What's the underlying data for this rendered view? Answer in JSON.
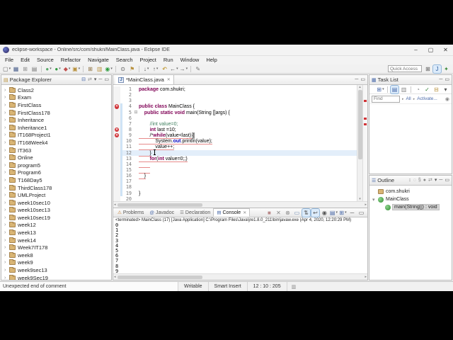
{
  "window": {
    "title": "eclipse-workspace - Online/src/com/shukri/MainClass.java - Eclipse IDE",
    "controls": [
      {
        "name": "minimize-button",
        "glyph": "–"
      },
      {
        "name": "maximize-button",
        "glyph": "▢"
      },
      {
        "name": "close-button",
        "glyph": "✕"
      }
    ]
  },
  "menubar": [
    "File",
    "Edit",
    "Source",
    "Refactor",
    "Navigate",
    "Search",
    "Project",
    "Run",
    "Window",
    "Help"
  ],
  "toolbar": {
    "quick_access": "Quick Access",
    "caret_glyph": "▾",
    "icons": [
      {
        "name": "new-wizard-icon",
        "glyph": "▢",
        "color": "#666",
        "caret": true
      },
      {
        "name": "save-icon",
        "glyph": "▦",
        "color": "#4a5f8c"
      },
      {
        "name": "save-all-icon",
        "glyph": "⊞",
        "color": "#8a8a8a"
      },
      {
        "name": "print-icon",
        "glyph": "▤",
        "color": "#777"
      },
      {
        "sep": true
      },
      {
        "name": "debug-icon",
        "glyph": "●",
        "color": "#59a869",
        "caret": true
      },
      {
        "name": "run-icon",
        "glyph": "●",
        "color": "#2e9b3e",
        "caret": true
      },
      {
        "name": "profile-icon",
        "glyph": "◆",
        "color": "#c0504d",
        "caret": true
      },
      {
        "name": "coverage-icon",
        "glyph": "▣",
        "color": "#b8913d",
        "caret": true
      },
      {
        "sep": true
      },
      {
        "name": "new-java-project-icon",
        "glyph": "⊞",
        "color": "#8a6d3b"
      },
      {
        "name": "new-package-icon",
        "glyph": "▥",
        "color": "#b8913d"
      },
      {
        "name": "new-class-icon",
        "glyph": "◉",
        "color": "#2e9b3e",
        "caret": true
      },
      {
        "sep": true
      },
      {
        "name": "search-icon",
        "glyph": "⊙",
        "color": "#555"
      },
      {
        "name": "open-task-icon",
        "glyph": "⚑",
        "color": "#b8913d"
      },
      {
        "sep": true
      },
      {
        "name": "next-annotation-icon",
        "glyph": "↓",
        "color": "#555",
        "caret": true
      },
      {
        "name": "prev-annotation-icon",
        "glyph": "↑",
        "color": "#555",
        "caret": true
      },
      {
        "name": "last-edit-location-icon",
        "glyph": "↶",
        "color": "#b8860b"
      },
      {
        "name": "back-icon",
        "glyph": "←",
        "color": "#555",
        "caret": true
      },
      {
        "name": "forward-icon",
        "glyph": "→",
        "color": "#555",
        "caret": true
      },
      {
        "sep": true
      },
      {
        "name": "mark-occurrences-icon",
        "glyph": "✎",
        "color": "#777"
      }
    ],
    "right_icons": [
      {
        "name": "open-perspective-icon",
        "glyph": "⊞",
        "color": "#555"
      },
      {
        "name": "java-perspective-icon",
        "glyph": "J",
        "color": "#2f5f9f",
        "toggled": true
      },
      {
        "name": "debug-perspective-icon",
        "glyph": "✦",
        "color": "#3c8c3c"
      }
    ]
  },
  "package_explorer": {
    "title": "Package Explorer",
    "tab_icon": "▤",
    "twist_glyph": "›",
    "header_icons": [
      {
        "name": "collapse-all-icon",
        "glyph": "⊟",
        "color": "#4868a8"
      },
      {
        "name": "link-with-editor-icon",
        "glyph": "⇄",
        "color": "#888"
      },
      {
        "name": "view-menu-icon",
        "glyph": "▾",
        "color": "#555"
      },
      {
        "name": "minimize-icon",
        "glyph": "─",
        "color": "#555"
      },
      {
        "name": "maximize-icon",
        "glyph": "▭",
        "color": "#555"
      }
    ],
    "items": [
      "Class2",
      "Exam",
      "FirstClass",
      "FirstClass178",
      "Inheritance",
      "Inheritance1",
      "IT168Project1",
      "IT168Week4",
      "IT363",
      "Online",
      "program5",
      "Program6",
      "T168Day5",
      "ThirdClass178",
      "UMLProject",
      "week10sec10",
      "week10sec13",
      "week10sec19",
      "week12",
      "week13",
      "week14",
      "Week7IT178",
      "week8",
      "week9",
      "week9sec13",
      "week9Sec19"
    ]
  },
  "editor": {
    "tab": {
      "icon_label": "J",
      "title": "*MainClass.java",
      "close_glyph": "✕"
    },
    "header_icons": [
      {
        "name": "minimize-icon",
        "glyph": "─",
        "color": "#555"
      },
      {
        "name": "maximize-icon",
        "glyph": "▭",
        "color": "#555"
      }
    ],
    "error_glyph": "✕",
    "fold_glyph": "⊟",
    "range_indicator": {
      "from": 4,
      "to": 19
    },
    "scrollbar": {
      "up": "▴",
      "down": "▾",
      "left": "◂",
      "right": "▸"
    },
    "overview_marks": [
      {
        "top": "13%",
        "color": "#d13438"
      },
      {
        "top": "28%",
        "color": "#d13438"
      },
      {
        "top": "33%",
        "color": "#d13438"
      }
    ],
    "lines": [
      {
        "n": 1,
        "segs": [
          [
            "kw",
            "package"
          ],
          [
            "p",
            " com.shukri;"
          ]
        ]
      },
      {
        "n": 2,
        "segs": []
      },
      {
        "n": 3,
        "segs": []
      },
      {
        "n": 4,
        "marker": "error",
        "segs": [
          [
            "kw",
            "public"
          ],
          [
            "p",
            " "
          ],
          [
            "kw",
            "class"
          ],
          [
            "p",
            " MainClass {"
          ]
        ]
      },
      {
        "n": 5,
        "fold": true,
        "segs": [
          [
            "p",
            "    "
          ],
          [
            "kw",
            "public"
          ],
          [
            "p",
            " "
          ],
          [
            "kw",
            "static"
          ],
          [
            "p",
            " "
          ],
          [
            "kw",
            "void"
          ],
          [
            "p",
            " main(String []args) {"
          ]
        ]
      },
      {
        "n": 6,
        "segs": []
      },
      {
        "n": 7,
        "segs": [
          [
            "p",
            "        "
          ],
          [
            "com",
            "//int value=0;"
          ]
        ]
      },
      {
        "n": 8,
        "marker": "error",
        "segs": [
          [
            "p",
            "        "
          ],
          [
            "kw",
            "int"
          ],
          [
            "p",
            " last =10;"
          ]
        ]
      },
      {
        "n": 9,
        "marker": "error",
        "segs": [
          [
            "p u",
            "        /*"
          ],
          [
            "kw u",
            "while"
          ],
          [
            "p u",
            "(value<last) "
          ],
          [
            "box",
            "{"
          ]
        ]
      },
      {
        "n": 10,
        "segs": [
          [
            "p u",
            "            System."
          ],
          [
            "field u",
            "out"
          ],
          [
            "p u",
            ".println(value);"
          ]
        ]
      },
      {
        "n": 11,
        "segs": [
          [
            "p u",
            "            value++;"
          ]
        ]
      },
      {
        "n": 12,
        "hl": true,
        "caret": true,
        "segs": [
          [
            "p u",
            "        }"
          ],
          [
            "p",
            "  "
          ]
        ]
      },
      {
        "n": 13,
        "segs": [
          [
            "p u",
            "        "
          ],
          [
            "kw u",
            "for"
          ],
          [
            "p u",
            "("
          ],
          [
            "kw u",
            "int"
          ],
          [
            "p u",
            " value=0;;)"
          ]
        ]
      },
      {
        "n": 14,
        "segs": [
          [
            "p u",
            "        "
          ]
        ]
      },
      {
        "n": 15,
        "segs": [
          [
            "p u",
            "        "
          ]
        ]
      },
      {
        "n": 16,
        "segs": [
          [
            "p u",
            "    }"
          ]
        ]
      },
      {
        "n": 17,
        "segs": []
      },
      {
        "n": 18,
        "segs": []
      },
      {
        "n": 19,
        "segs": [
          [
            "p",
            "}"
          ]
        ]
      },
      {
        "n": 20,
        "segs": []
      }
    ]
  },
  "console": {
    "tabs": [
      {
        "name": "tab-problems",
        "icon": "⚠",
        "icon_color": "#c87f2f",
        "label": "Problems"
      },
      {
        "name": "tab-javadoc",
        "icon": "@",
        "icon_color": "#4868a8",
        "label": "Javadoc"
      },
      {
        "name": "tab-declaration",
        "icon": "☰",
        "icon_color": "#777",
        "label": "Declaration"
      },
      {
        "name": "tab-console",
        "icon": "▤",
        "icon_color": "#4868a8",
        "label": "Console",
        "active": true,
        "close": "✕"
      }
    ],
    "toolbar_icons": [
      {
        "name": "terminate-icon",
        "glyph": "■",
        "color": "#b98a8a"
      },
      {
        "name": "remove-launch-icon",
        "glyph": "✕",
        "color": "#888"
      },
      {
        "name": "remove-all-launches-icon",
        "glyph": "⊗",
        "color": "#888"
      },
      {
        "name": "clear-console-icon",
        "glyph": "▭",
        "color": "#6a87b0"
      },
      {
        "name": "scroll-lock-icon",
        "glyph": "⇅",
        "color": "#555",
        "toggled": true
      },
      {
        "name": "word-wrap-icon",
        "glyph": "↩",
        "color": "#555",
        "toggled": true
      },
      {
        "name": "pin-console-icon",
        "glyph": "◉",
        "color": "#555"
      },
      {
        "name": "display-selected-console-icon",
        "glyph": "▤",
        "color": "#4868a8",
        "caret": true
      },
      {
        "name": "open-console-icon",
        "glyph": "⊞",
        "color": "#4868a8",
        "caret": true
      },
      {
        "name": "minimize-icon",
        "glyph": "─",
        "color": "#555"
      },
      {
        "name": "maximize-icon",
        "glyph": "▭",
        "color": "#555"
      }
    ],
    "header": "<terminated> MainClass (17) [Java Application] C:\\Program Files\\Java\\jre1.8.0_211\\bin\\javaw.exe (Apr 4, 2020, 12:20:29 PM)",
    "output": [
      "0",
      "1",
      "2",
      "3",
      "4",
      "5",
      "6",
      "7",
      "8",
      "9"
    ]
  },
  "task_list": {
    "title": "Task List",
    "tab_icon": "▦",
    "header_icons": [
      {
        "name": "minimize-icon",
        "glyph": "─",
        "color": "#555"
      },
      {
        "name": "maximize-icon",
        "glyph": "▭",
        "color": "#555"
      }
    ],
    "toolbar_icons": [
      {
        "name": "new-task-icon",
        "glyph": "⊞",
        "color": "#4868a8",
        "caret": true
      },
      {
        "sep": true
      },
      {
        "name": "categorized-icon",
        "glyph": "▤",
        "color": "#4868a8",
        "toggled": true
      },
      {
        "name": "scheduled-icon",
        "glyph": "▥",
        "color": "#888"
      },
      {
        "sep": true
      },
      {
        "name": "focus-workweek-icon",
        "glyph": "◔",
        "color": "#888"
      },
      {
        "name": "filter-completed-icon",
        "glyph": "✓",
        "color": "#2e7d32"
      },
      {
        "name": "group-by-icon",
        "glyph": "⊟",
        "color": "#b8913d"
      },
      {
        "name": "view-menu-icon",
        "glyph": "▾",
        "color": "#555"
      }
    ],
    "find_placeholder": "Find",
    "sep_glyph": "▸",
    "all_label": "All",
    "activate_label": "Activate...",
    "help_glyph": "◉"
  },
  "outline": {
    "title": "Outline",
    "tab_icon": "☰",
    "twist_glyph": "▾",
    "header_icons": [
      {
        "name": "sort-icon",
        "glyph": "↕",
        "color": "#888"
      },
      {
        "name": "hide-fields-icon",
        "glyph": "◌",
        "color": "#888"
      },
      {
        "name": "hide-static-icon",
        "glyph": "§",
        "color": "#888"
      },
      {
        "name": "hide-non-public-icon",
        "glyph": "●",
        "color": "#888"
      },
      {
        "name": "link-with-editor-icon",
        "glyph": "⇄",
        "color": "#888"
      },
      {
        "name": "view-menu-icon",
        "glyph": "▾",
        "color": "#555"
      },
      {
        "name": "minimize-icon",
        "glyph": "─",
        "color": "#555"
      },
      {
        "name": "maximize-icon",
        "glyph": "▭",
        "color": "#555"
      }
    ],
    "items": [
      {
        "icon": "pkg",
        "icon_name": "package-icon",
        "label": "com.shukri",
        "indent": 0
      },
      {
        "icon": "cls",
        "icon_name": "class-icon",
        "label": "MainClass",
        "indent": 0,
        "twist": true
      },
      {
        "icon": "mth",
        "icon_name": "method-icon",
        "label": "main(String[]) : void",
        "indent": 1,
        "selected": true
      }
    ]
  },
  "statusbar": {
    "message": "Unexpected end of comment",
    "writable": "Writable",
    "insert_mode": "Smart Insert",
    "position": "12 : 10 : 205",
    "icon_glyph": "▥"
  }
}
